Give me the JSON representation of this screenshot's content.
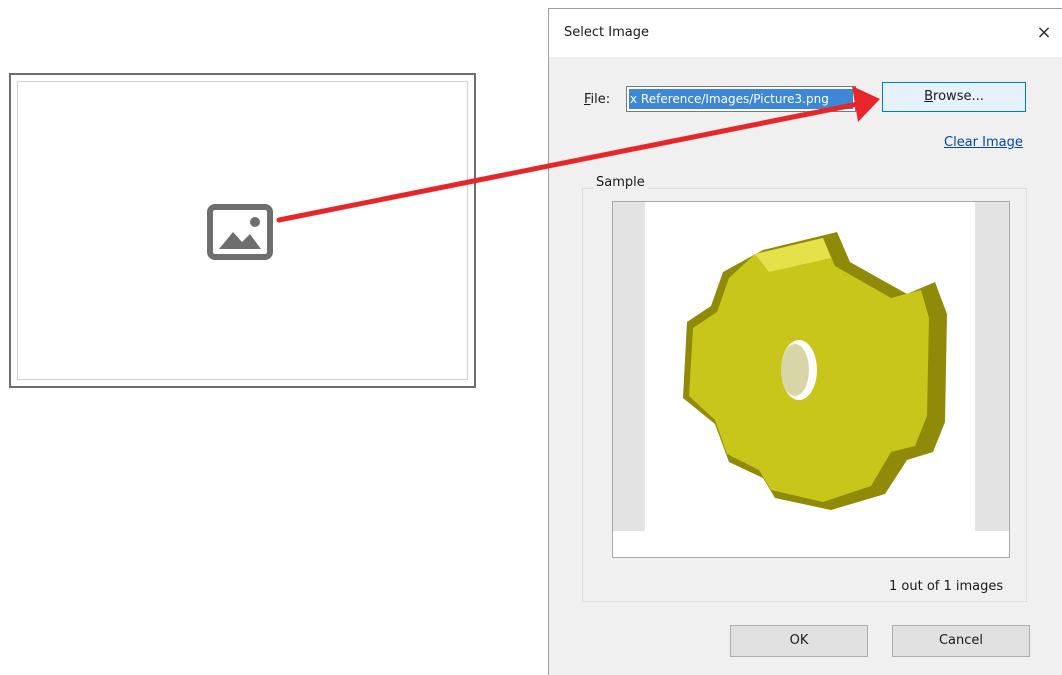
{
  "placeholder": {
    "icon": "image-placeholder-icon"
  },
  "dialog": {
    "title": "Select Image",
    "close_label": "×",
    "file_label_accel": "F",
    "file_label_rest": "ile:",
    "file_value": "x Reference/Images/Picture3.png",
    "browse_accel": "B",
    "browse_rest": "rowse...",
    "clear_image_label": "Clear Image",
    "sample_label": "Sample",
    "image_count": "1 out of 1 images",
    "ok_label": "OK",
    "cancel_label": "Cancel"
  },
  "annotation": {
    "arrow_color": "#e8262a"
  },
  "preview": {
    "gear_color": "#c8c61a"
  }
}
